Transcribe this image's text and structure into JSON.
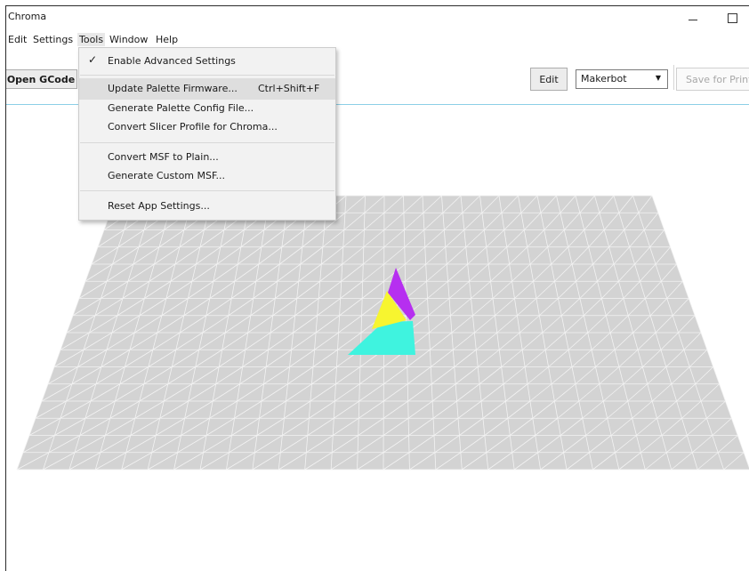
{
  "window": {
    "title": "Chroma",
    "minimize": "–",
    "maximize": "☐"
  },
  "menubar": [
    "Edit",
    "Settings",
    "Tools",
    "Window",
    "Help"
  ],
  "toolbar": {
    "open_gcode": "Open GCode",
    "edit": "Edit",
    "printer_select": "Makerbot",
    "save_for_print": "Save for Print"
  },
  "tools_menu": {
    "items": [
      {
        "label": "Enable Advanced Settings",
        "checked": true,
        "shortcut": ""
      },
      {
        "label": "Update Palette Firmware...",
        "checked": false,
        "shortcut": "Ctrl+Shift+F",
        "highlighted": true
      },
      {
        "label": "Generate Palette Config File...",
        "checked": false,
        "shortcut": ""
      },
      {
        "label": "Convert Slicer Profile for Chroma...",
        "checked": false,
        "shortcut": ""
      },
      {
        "label": "Convert MSF to Plain...",
        "checked": false,
        "shortcut": ""
      },
      {
        "label": "Generate Custom MSF...",
        "checked": false,
        "shortcut": ""
      },
      {
        "label": "Reset App Settings...",
        "checked": false,
        "shortcut": ""
      }
    ],
    "check_glyph": "✓"
  },
  "viewport": {
    "bed_color": "#d3d3d3",
    "grid_color": "#f3f3f3",
    "model_colors": [
      "#3ff3df",
      "#f7f52f",
      "#b62ff0"
    ]
  },
  "colors": {
    "toolbar_divider": "#8ccfe6"
  }
}
